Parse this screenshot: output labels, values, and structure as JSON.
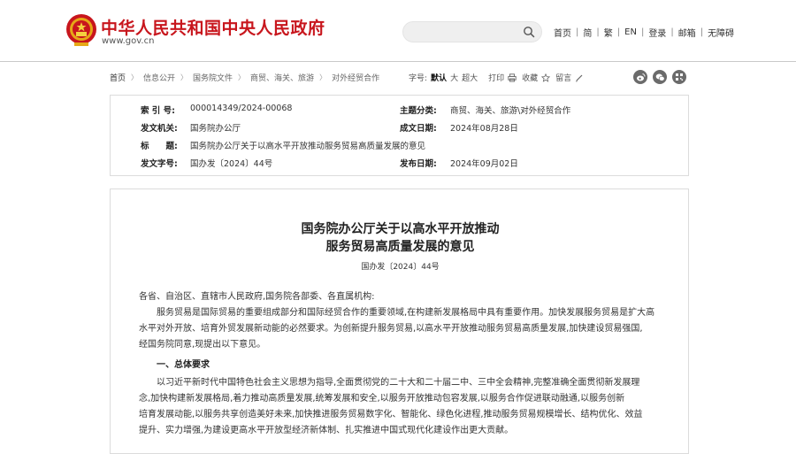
{
  "header": {
    "site_title": "中华人民共和国中央人民政府",
    "site_url": "www.gov.cn",
    "search_placeholder": "",
    "nav": [
      "首页",
      "简",
      "繁",
      "EN",
      "登录",
      "邮箱",
      "无障碍"
    ],
    "brand_color": "#c8161d"
  },
  "breadcrumb": {
    "items": [
      "首页",
      "信息公开",
      "国务院文件",
      "商贸、海关、旅游",
      "对外经贸合作"
    ]
  },
  "tools": {
    "font_label": "字号:",
    "font_default": "默认",
    "font_large": "大",
    "font_xlarge": "超大",
    "print": "打印",
    "favorite": "收藏",
    "keep": "留言"
  },
  "info": {
    "index_label": "索 引 号:",
    "index_value": "000014349/2024-00068",
    "topic_label": "主题分类:",
    "topic_value": "商贸、海关、旅游\\对外经贸合作",
    "issuer_label": "发文机关:",
    "issuer_value": "国务院办公厅",
    "written_label": "成文日期:",
    "written_value": "2024年08月28日",
    "title_label": "标　　题:",
    "title_value": "国务院办公厅关于以高水平开放推动服务贸易高质量发展的意见",
    "docno_label": "发文字号:",
    "docno_value": "国办发〔2024〕44号",
    "published_label": "发布日期:",
    "published_value": "2024年09月02日"
  },
  "article": {
    "title_line1": "国务院办公厅关于以高水平开放推动",
    "title_line2": "服务贸易高质量发展的意见",
    "doc_number": "国办发〔2024〕44号",
    "salutation": "各省、自治区、直辖市人民政府,国务院各部委、各直属机构:",
    "para1": [
      "　　服务贸易是国际贸易的重要组成部分和国际经贸合作的重要领域,在构建新发展格局中具有重要作用。加快发展服务贸易是扩大高",
      "水平对外开放、培育外贸发展新动能的必然要求。为创新提升服务贸易,以高水平开放推动服务贸易高质量发展,加快建设贸易强国,",
      "经国务院同意,现提出以下意见。"
    ],
    "heading1": "一、总体要求",
    "para2": [
      "　　以习近平新时代中国特色社会主义思想为指导,全面贯彻党的二十大和二十届二中、三中全会精神,完整准确全面贯彻新发展理",
      "念,加快构建新发展格局,着力推动高质量发展,统筹发展和安全,以服务开放推动包容发展,以服务合作促进联动融通,以服务创新",
      "培育发展动能,以服务共享创造美好未来,加快推进服务贸易数字化、智能化、绿色化进程,推动服务贸易规模增长、结构优化、效益",
      "提升、实力增强,为建设更高水平开放型经济新体制、扎实推进中国式现代化建设作出更大贡献。"
    ]
  }
}
